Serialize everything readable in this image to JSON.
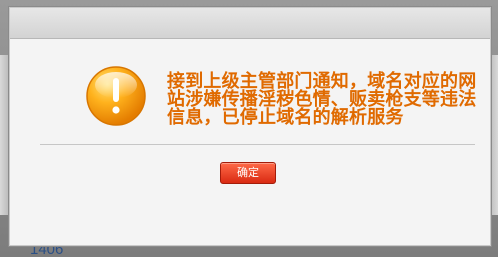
{
  "dialog": {
    "message": "接到上级主管部门通知，域名对应的网站涉嫌传播淫秽色情、贩卖枪支等违法信息，已停止域名的解析服务",
    "ok_label": "确定",
    "icon": "exclamation-warning-icon"
  },
  "background": {
    "partial_number": "1406"
  },
  "colors": {
    "message_text": "#e06a00",
    "button_red": "#e23a1d",
    "icon_orange": "#f59b00"
  }
}
